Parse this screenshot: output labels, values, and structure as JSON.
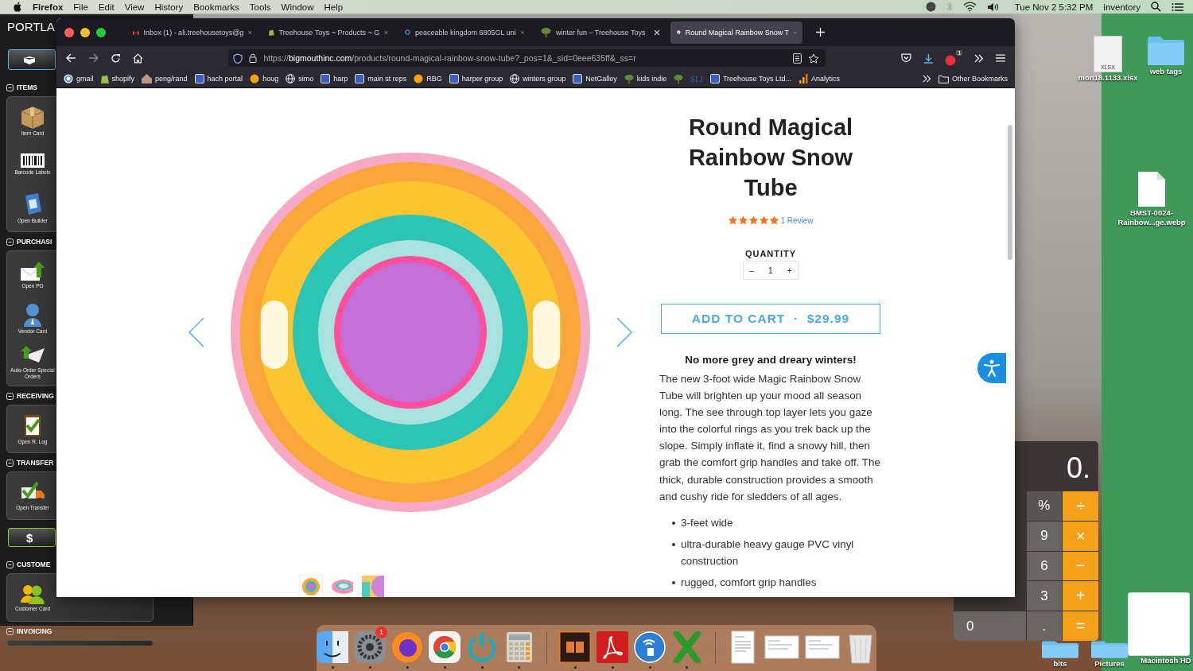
{
  "menubar": {
    "app": "Firefox",
    "menus": [
      "File",
      "Edit",
      "View",
      "History",
      "Bookmarks",
      "Tools",
      "Window",
      "Help"
    ],
    "clock": "Tue Nov 2  5:32 PM",
    "user": "inventory"
  },
  "pos_app": {
    "title": "PORTLA",
    "sections": [
      {
        "kind": "section",
        "title": "ITEMS",
        "expanded": true,
        "items": [
          {
            "label": "Item Card",
            "kind": "box"
          },
          {
            "label": "Barcode Labels",
            "kind": "barcode"
          },
          {
            "label": "Open Builder",
            "kind": "book"
          }
        ]
      },
      {
        "kind": "section",
        "title": "PURCHASI",
        "expanded": true,
        "items": [
          {
            "label": "Open PO",
            "kind": "mail"
          },
          {
            "label": "Vendor Card",
            "kind": "person"
          },
          {
            "label": "Auto-Order Special Orders",
            "kind": "plane"
          }
        ]
      },
      {
        "kind": "section",
        "title": "RECEIVING",
        "expanded": true,
        "items": [
          {
            "label": "Open R. Log",
            "kind": "clipboard"
          }
        ]
      },
      {
        "kind": "section",
        "title": "TRANSFER",
        "expanded": true,
        "items": [
          {
            "label": "Open Transfer",
            "kind": "truck"
          }
        ]
      },
      {
        "kind": "button",
        "title": "$"
      },
      {
        "kind": "section",
        "title": "CUSTOME",
        "expanded": true,
        "items": [
          {
            "label": "Customer Card",
            "kind": "people"
          }
        ]
      },
      {
        "kind": "section",
        "title": "INVOICING",
        "expanded": true
      }
    ]
  },
  "browser": {
    "tabs": [
      {
        "title": "Inbox (1) - ali.treehousetoys@g",
        "kind": "mail",
        "selected": false
      },
      {
        "title": "Treehouse Toys ~ Products ~ G",
        "kind": "bag",
        "selected": false
      },
      {
        "title": "peaceable kingdom 6805GL uni",
        "kind": "ring",
        "selected": false
      },
      {
        "title": "winter fun – Treehouse Toys",
        "kind": "tree",
        "selected": false
      },
      {
        "title": "Round Magical Rainbow Snow T",
        "kind": "face",
        "selected": true
      }
    ],
    "url": "https://**bigmouthinc.com**/products/round-magical-rainbow-snow-tube?_pos=1&_sid=0eee635ff&_ss=r",
    "extension_badge": "1",
    "bookmarks": [
      {
        "label": "gmail",
        "kind": "ring"
      },
      {
        "label": "shopify",
        "kind": "bag"
      },
      {
        "label": "peng/rand",
        "kind": "house"
      },
      {
        "label": "hach portal",
        "kind": "square"
      },
      {
        "label": "houg",
        "kind": "circle"
      },
      {
        "label": "simo",
        "kind": "globe"
      },
      {
        "label": "harp",
        "kind": "square"
      },
      {
        "label": "main st reps",
        "kind": "square"
      },
      {
        "label": "RBG",
        "kind": "circle"
      },
      {
        "label": "harper group",
        "kind": "square"
      },
      {
        "label": "winters group",
        "kind": "globe"
      },
      {
        "label": "NetGalley",
        "kind": "square"
      },
      {
        "label": "kids indie",
        "kind": "tree"
      },
      {
        "kind": "tree"
      },
      {
        "label": "SLJ",
        "kind": "text"
      },
      {
        "label": "Treehouse Toys Ltd...",
        "kind": "square"
      },
      {
        "label": "Analytics",
        "kind": "bars"
      }
    ],
    "other_bookmarks": "Other Bookmarks"
  },
  "page": {
    "title": "Round Magical Rainbow Snow Tube",
    "stars": 5,
    "reviews": "1 Review",
    "quantity_label": "QUANTITY",
    "decrease": "–",
    "quantity": "1",
    "increase": "+",
    "add_to_cart": "ADD TO CART  ·  $29.99",
    "headline": "No more grey and dreary winters!",
    "description": "The new 3-foot wide Magic Rainbow Snow Tube will brighten up your mood all season long. The see through top layer lets you gaze into the colorful rings as you trek back up the slope. Simply inflate it, find a snowy hill, then grab the comfort grip handles and take off. The thick, durable construction provides a smooth and cushy ride for sledders of all ages.",
    "bullets": [
      "3-feet wide",
      "ultra-durable heavy gauge PVC vinyl construction",
      "rugged, comfort grip handles"
    ],
    "thumbnails": [
      {
        "selected": true
      },
      {
        "selected": false
      },
      {
        "selected": false
      }
    ]
  },
  "calculator": {
    "display": "0.",
    "zero_key": "0",
    "columns": [
      {
        "kind": "digit",
        "keys": [
          "%",
          "9",
          "6",
          "3",
          "."
        ]
      },
      {
        "kind": "operator",
        "keys": [
          "÷",
          "×",
          "−",
          "+",
          "="
        ]
      }
    ]
  },
  "desktop_icons": [
    {
      "label": "mon18.1133.xlsx",
      "kind": "sheet",
      "badge": "XLSX"
    },
    {
      "label": "web tags",
      "kind": "folder"
    },
    {
      "label": "BMST-0024-Rainbow...ge.webp",
      "kind": "file"
    },
    {
      "label": "bits",
      "kind": "folder"
    },
    {
      "label": "Pictures",
      "kind": "folder"
    },
    {
      "label": "Macintosh HD",
      "kind": "disk"
    }
  ],
  "dock": [
    {
      "kind": "finder",
      "running": true
    },
    {
      "kind": "gear",
      "running": true,
      "badge": "1"
    },
    {
      "kind": "fox",
      "running": true
    },
    {
      "kind": "ring",
      "running": true
    },
    {
      "kind": "power",
      "running": true
    },
    {
      "kind": "calc",
      "running": true
    },
    {
      "kind": "separator"
    },
    {
      "kind": "panel",
      "running": true
    },
    {
      "kind": "pdf",
      "running": true
    },
    {
      "kind": "arcs",
      "running": true
    },
    {
      "kind": "cross",
      "running": true
    },
    {
      "kind": "separator"
    },
    {
      "kind": "doc",
      "running": false
    },
    {
      "kind": "shot",
      "running": false
    },
    {
      "kind": "shot",
      "running": false
    },
    {
      "kind": "trash",
      "running": false
    }
  ]
}
